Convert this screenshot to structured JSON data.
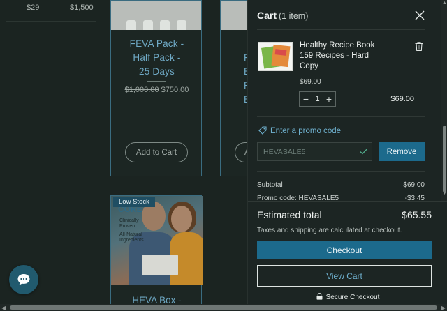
{
  "background": {
    "left_prices": [
      "$29",
      "$1,500"
    ],
    "products": [
      {
        "title_lines": [
          "FEVA Pack -",
          "Half Pack -",
          "25 Days"
        ],
        "old_price": "$1,000.00",
        "price": "$750.00",
        "button": "Add to Cart"
      },
      {
        "title_lines": [
          "F",
          "B",
          "F",
          "E"
        ],
        "button": "A"
      },
      {
        "badge": "Low Stock",
        "image_text": {
          "heading": "CORE",
          "bullet_1": [
            "Clinically",
            "Proven"
          ],
          "bullet_2": [
            "All-Natural",
            "Ingredients"
          ]
        },
        "title": "HEVA Box -"
      }
    ],
    "chat_icon": "chat-bubble-icon"
  },
  "cart": {
    "title": "Cart",
    "count_label": "(1 item)",
    "item": {
      "name": "Healthy Recipe Book 159 Recipes - Hard Copy",
      "unit_price": "$69.00",
      "quantity": "1",
      "total": "$69.00"
    },
    "promo": {
      "link_label": "Enter a promo code",
      "code_value": "HEVASALE5",
      "remove_label": "Remove"
    },
    "summary": {
      "subtotal_label": "Subtotal",
      "subtotal_value": "$69.00",
      "promo_label": "Promo code: HEVASALE5",
      "promo_value": "-$3.45"
    },
    "footer": {
      "estimated_label": "Estimated total",
      "estimated_value": "$65.55",
      "tax_note": "Taxes and shipping are calculated at checkout.",
      "checkout_label": "Checkout",
      "view_cart_label": "View Cart",
      "secure_label": "Secure Checkout"
    },
    "colors": {
      "accent": "#1c6a8c",
      "link": "#6fb1cf",
      "panel": "#1c2523"
    }
  }
}
